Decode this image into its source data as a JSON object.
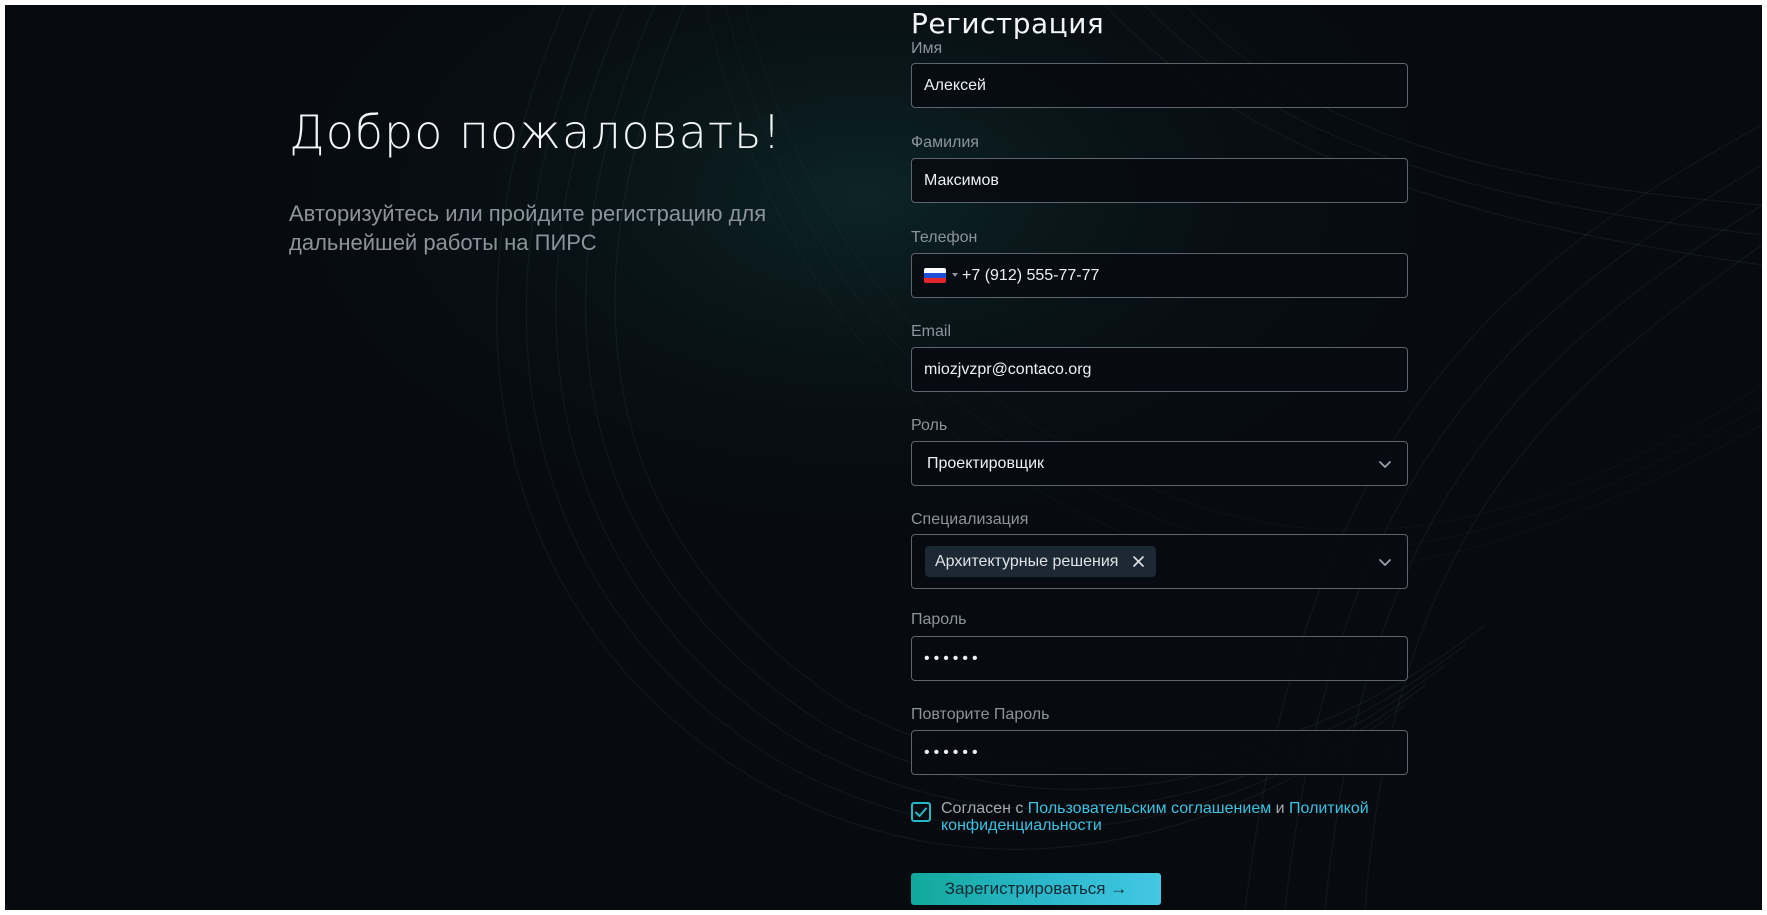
{
  "welcome": {
    "title": "Добро пожаловать!",
    "subtitle": "Авторизуйтесь или пройдите регистрацию для дальнейшей работы на ПИРС"
  },
  "form": {
    "title": "Регистрация",
    "first_name": {
      "label": "Имя",
      "value": "Алексей"
    },
    "last_name": {
      "label": "Фамилия",
      "value": "Максимов"
    },
    "phone": {
      "label": "Телефон",
      "value": "+7 (912) 555-77-77",
      "flag_icon": "russia-flag-icon"
    },
    "email": {
      "label": "Email",
      "value": "miozjvzpr@contaco.org"
    },
    "role": {
      "label": "Роль",
      "value": "Проектировщик"
    },
    "specialization": {
      "label": "Специализация",
      "tag": "Архитектурные решения"
    },
    "password": {
      "label": "Пароль",
      "value": "••••••"
    },
    "password_repeat": {
      "label": "Повторите Пароль",
      "value": "••••••"
    },
    "consent": {
      "checked": true,
      "prefix": "Согласен с ",
      "agreement_link": "Пользовательским соглашением",
      "conjunction": " и ",
      "privacy_link": "Политикой конфиденциальности"
    },
    "submit_label": "Зарегистрироваться →"
  },
  "colors": {
    "background": "#070b10",
    "accent": "#3ec1e0",
    "checkbox": "#22b8c4",
    "button_gradient_start": "#12a89b",
    "button_gradient_end": "#43c7e3"
  }
}
